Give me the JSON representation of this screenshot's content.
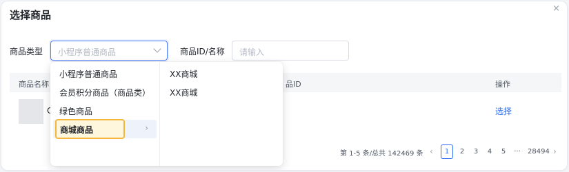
{
  "dialog": {
    "title": "选择商品",
    "close": "×"
  },
  "filters": {
    "type_label": "商品类型",
    "type_placeholder": "小程序普通商品",
    "id_label": "商品ID/名称",
    "id_placeholder": "请输入"
  },
  "table": {
    "headers": {
      "name": "商品名称",
      "id": "品ID",
      "op": "操作"
    },
    "row": {
      "name_fragment": "C",
      "op": "选择"
    }
  },
  "pagination": {
    "total": "第 1-5 条/总共 142469 条",
    "prev": "‹",
    "pages": [
      "1",
      "2",
      "3",
      "4",
      "5"
    ],
    "active": "1",
    "ellipsis": "···",
    "last": "28494",
    "next": "›"
  },
  "dropdown": {
    "level1": [
      "小程序普通商品",
      "会员积分商品（商品类）",
      "绿色商品",
      "商城商品"
    ],
    "selected": "商城商品",
    "selected_arrow": "›",
    "level2": [
      "XX商城",
      "XX商城"
    ]
  },
  "colors": {
    "accent": "#2f6bf2",
    "highlight_border": "#f5b73a"
  }
}
